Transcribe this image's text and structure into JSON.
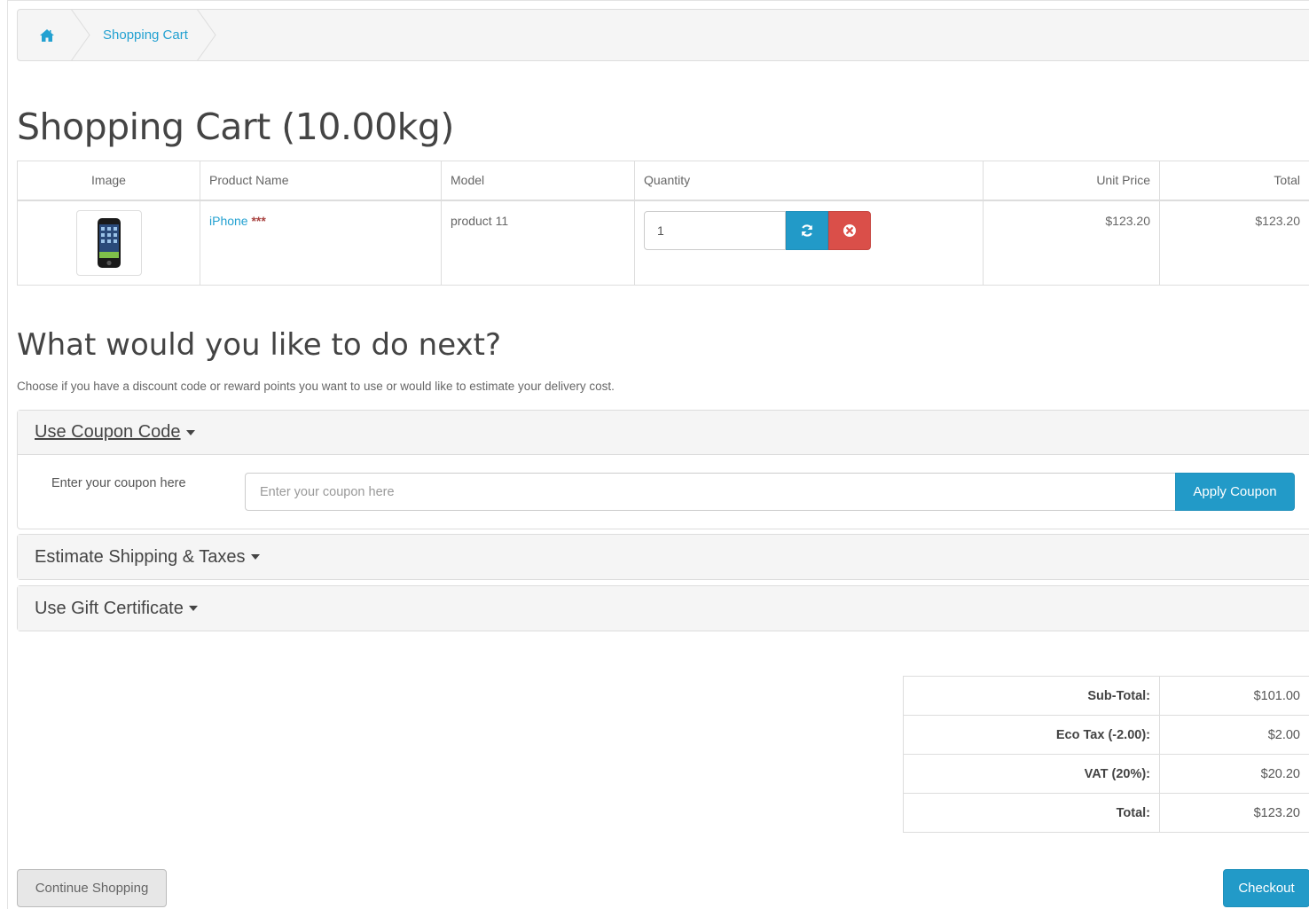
{
  "breadcrumb": {
    "home_icon": "home-icon",
    "current": "Shopping Cart"
  },
  "page": {
    "title": "Shopping Cart  (10.00kg)"
  },
  "cart": {
    "headers": {
      "image": "Image",
      "product_name": "Product Name",
      "model": "Model",
      "quantity": "Quantity",
      "unit_price": "Unit Price",
      "total": "Total"
    },
    "items": [
      {
        "product_name": "iPhone",
        "stock_flag": "***",
        "model": "product 11",
        "quantity": "1",
        "unit_price": "$123.20",
        "total": "$123.20",
        "update_icon": "refresh-icon",
        "remove_icon": "remove-circle-icon"
      }
    ]
  },
  "next": {
    "title": "What would you like to do next?",
    "description": "Choose if you have a discount code or reward points you want to use or would like to estimate your delivery cost."
  },
  "coupon": {
    "heading": "Use Coupon Code",
    "label": "Enter your coupon here",
    "placeholder": "Enter your coupon here",
    "button": "Apply Coupon"
  },
  "shipping": {
    "heading": "Estimate Shipping & Taxes"
  },
  "voucher": {
    "heading": "Use Gift Certificate"
  },
  "totals": [
    {
      "label": "Sub-Total:",
      "value": "$101.00"
    },
    {
      "label": "Eco Tax (-2.00):",
      "value": "$2.00"
    },
    {
      "label": "VAT (20%):",
      "value": "$20.20"
    },
    {
      "label": "Total:",
      "value": "$123.20"
    }
  ],
  "buttons": {
    "continue": "Continue Shopping",
    "checkout": "Checkout"
  },
  "colors": {
    "link": "#23a1d1",
    "primary": "#229ac8",
    "danger": "#da4f49",
    "stock_warning": "#a94442"
  }
}
